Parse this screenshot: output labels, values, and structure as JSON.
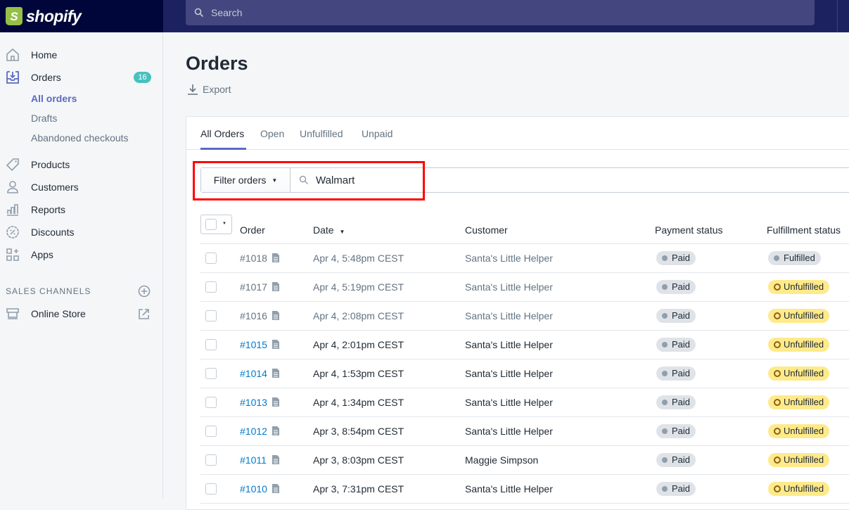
{
  "brand": {
    "name": "shopify",
    "logo_letter": "S"
  },
  "search": {
    "placeholder": "Search"
  },
  "sidebar": {
    "items": [
      {
        "label": "Home",
        "icon": "home-icon"
      },
      {
        "label": "Orders",
        "icon": "orders-icon",
        "badge": "16"
      },
      {
        "label": "Products",
        "icon": "tag-icon"
      },
      {
        "label": "Customers",
        "icon": "person-icon"
      },
      {
        "label": "Reports",
        "icon": "bar-chart-icon"
      },
      {
        "label": "Discounts",
        "icon": "discount-icon"
      },
      {
        "label": "Apps",
        "icon": "apps-icon"
      }
    ],
    "orders_sub": [
      "All orders",
      "Drafts",
      "Abandoned checkouts"
    ],
    "sales_channels_heading": "SALES CHANNELS",
    "online_store": "Online Store"
  },
  "page": {
    "title": "Orders",
    "export_label": "Export"
  },
  "tabs": [
    "All Orders",
    "Open",
    "Unfulfilled",
    "Unpaid"
  ],
  "filter": {
    "button_label": "Filter orders",
    "query": "Walmart"
  },
  "table": {
    "headers": {
      "order": "Order",
      "date": "Date",
      "customer": "Customer",
      "payment": "Payment status",
      "fulfillment": "Fulfillment status"
    },
    "rows": [
      {
        "order": "#1018",
        "date": "Apr 4, 5:48pm CEST",
        "customer": "Santa's Little Helper",
        "payment": "Paid",
        "fulfillment": "Fulfilled",
        "dim": true
      },
      {
        "order": "#1017",
        "date": "Apr 4, 5:19pm CEST",
        "customer": "Santa's Little Helper",
        "payment": "Paid",
        "fulfillment": "Unfulfilled",
        "dim": true
      },
      {
        "order": "#1016",
        "date": "Apr 4, 2:08pm CEST",
        "customer": "Santa's Little Helper",
        "payment": "Paid",
        "fulfillment": "Unfulfilled",
        "dim": true
      },
      {
        "order": "#1015",
        "date": "Apr 4, 2:01pm CEST",
        "customer": "Santa's Little Helper",
        "payment": "Paid",
        "fulfillment": "Unfulfilled",
        "dim": false
      },
      {
        "order": "#1014",
        "date": "Apr 4, 1:53pm CEST",
        "customer": "Santa's Little Helper",
        "payment": "Paid",
        "fulfillment": "Unfulfilled",
        "dim": false
      },
      {
        "order": "#1013",
        "date": "Apr 4, 1:34pm CEST",
        "customer": "Santa's Little Helper",
        "payment": "Paid",
        "fulfillment": "Unfulfilled",
        "dim": false
      },
      {
        "order": "#1012",
        "date": "Apr 3, 8:54pm CEST",
        "customer": "Santa's Little Helper",
        "payment": "Paid",
        "fulfillment": "Unfulfilled",
        "dim": false
      },
      {
        "order": "#1011",
        "date": "Apr 3, 8:03pm CEST",
        "customer": "Maggie Simpson",
        "payment": "Paid",
        "fulfillment": "Unfulfilled",
        "dim": false
      },
      {
        "order": "#1010",
        "date": "Apr 3, 7:31pm CEST",
        "customer": "Santa's Little Helper",
        "payment": "Paid",
        "fulfillment": "Unfulfilled",
        "dim": false
      }
    ]
  },
  "colors": {
    "accent": "#5c6ac4",
    "link": "#007ace",
    "badge": "#47c1bf",
    "highlight": "#ff0000"
  }
}
